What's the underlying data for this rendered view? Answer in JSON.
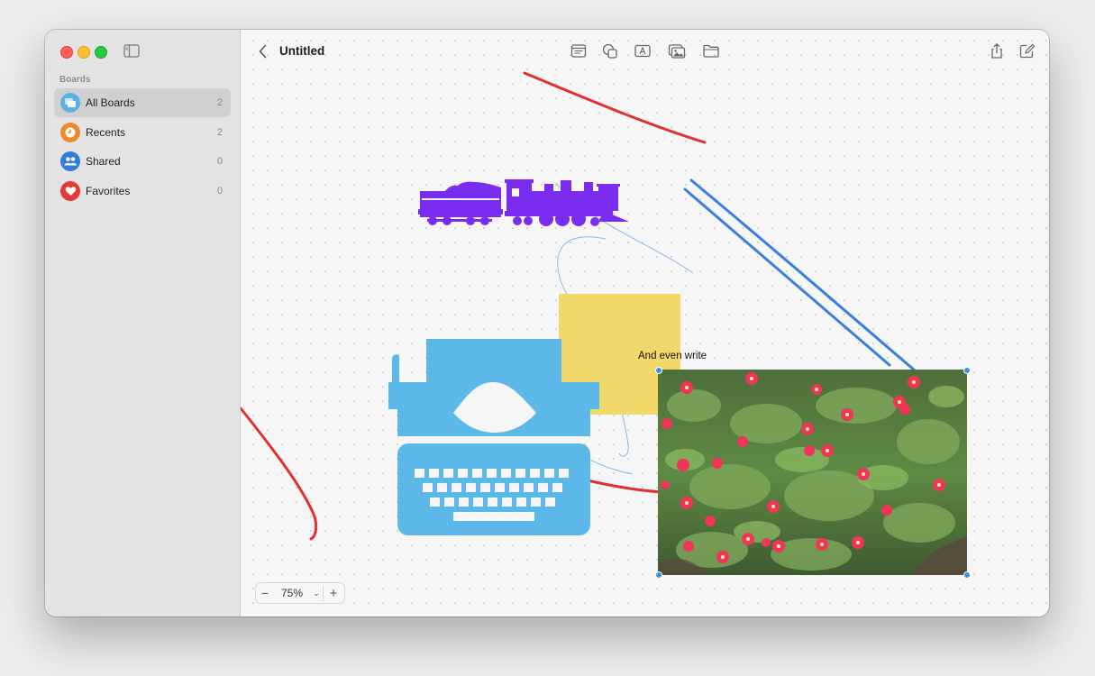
{
  "sidebar": {
    "heading": "Boards",
    "items": [
      {
        "label": "All Boards",
        "count": "2",
        "icon": "all-boards-icon",
        "color": "#5ab0e6"
      },
      {
        "label": "Recents",
        "count": "2",
        "icon": "clock-icon",
        "color": "#ea8a2a"
      },
      {
        "label": "Shared",
        "count": "0",
        "icon": "people-icon",
        "color": "#2f7be0"
      },
      {
        "label": "Favorites",
        "count": "0",
        "icon": "heart-icon",
        "color": "#e53935"
      }
    ]
  },
  "toolbar": {
    "title": "Untitled",
    "buttons": [
      "note-icon",
      "shapes-icon",
      "text-box-icon",
      "media-icon",
      "folder-icon"
    ],
    "right_buttons": [
      "share-icon",
      "compose-icon"
    ]
  },
  "canvas": {
    "text_item": "And even write",
    "zoom": {
      "value": "75%"
    },
    "colors": {
      "train": "#7a2cf0",
      "typewriter": "#5cb8e8",
      "sticky": "#f0d86a",
      "red_stroke": "#e03030",
      "blue_stroke": "#3b7de0"
    }
  }
}
